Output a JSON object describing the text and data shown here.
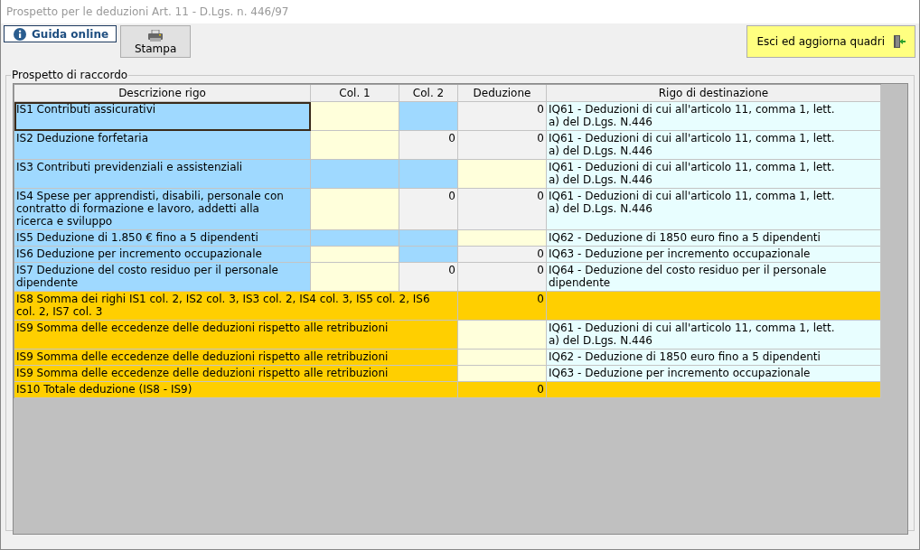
{
  "window": {
    "title": "Prospetto per le deduzioni Art. 11 - D.Lgs. n. 446/97"
  },
  "toolbar": {
    "help_button": "Guida online",
    "print_button": "Stampa",
    "exit_button": "Esci ed aggiorna quadri"
  },
  "group": {
    "title": "Prospetto di raccordo"
  },
  "table": {
    "columns": [
      "Descrizione rigo",
      "Col. 1",
      "Col. 2",
      "Deduzione",
      "Rigo di destinazione"
    ],
    "rows": [
      {
        "kind": "detail",
        "focused": true,
        "description": "IS1 Contributi assicurativi",
        "col1": {
          "kind": "input"
        },
        "col2": {
          "kind": "locked"
        },
        "deduzione": {
          "kind": "calc",
          "value": "0"
        },
        "destination": "IQ61 - Deduzioni di cui all'articolo 11, comma 1, lett. a) del D.Lgs. N.446"
      },
      {
        "kind": "detail",
        "focused": false,
        "description": "IS2 Deduzione forfetaria",
        "col1": {
          "kind": "input"
        },
        "col2": {
          "kind": "calc",
          "value": "0"
        },
        "deduzione": {
          "kind": "calc",
          "value": "0"
        },
        "destination": "IQ61 - Deduzioni di cui all'articolo 11, comma 1, lett. a) del D.Lgs. N.446"
      },
      {
        "kind": "detail",
        "focused": false,
        "description": "IS3 Contributi previdenziali e assistenziali",
        "col1": {
          "kind": "locked"
        },
        "col2": {
          "kind": "locked"
        },
        "deduzione": {
          "kind": "input"
        },
        "destination": "IQ61 - Deduzioni di cui all'articolo 11, comma 1, lett. a) del D.Lgs. N.446"
      },
      {
        "kind": "detail",
        "focused": false,
        "description": "IS4 Spese per apprendisti, disabili, personale con contratto di formazione e lavoro, addetti alla ricerca e sviluppo",
        "col1": {
          "kind": "input"
        },
        "col2": {
          "kind": "calc",
          "value": "0"
        },
        "deduzione": {
          "kind": "calc",
          "value": "0"
        },
        "destination": "IQ61 - Deduzioni di cui all'articolo 11, comma 1, lett. a) del D.Lgs. N.446"
      },
      {
        "kind": "detail",
        "focused": false,
        "description": "IS5 Deduzione di 1.850 € fino a 5 dipendenti",
        "col1": {
          "kind": "locked"
        },
        "col2": {
          "kind": "locked"
        },
        "deduzione": {
          "kind": "input"
        },
        "destination": "IQ62 - Deduzione di 1850 euro fino a 5 dipendenti"
      },
      {
        "kind": "detail",
        "focused": false,
        "description": "IS6 Deduzione per incremento occupazionale",
        "col1": {
          "kind": "input"
        },
        "col2": {
          "kind": "locked"
        },
        "deduzione": {
          "kind": "calc",
          "value": "0"
        },
        "destination": "IQ63 - Deduzione per incremento occupazionale"
      },
      {
        "kind": "detail",
        "focused": false,
        "description": "IS7 Deduzione del costo residuo per il personale dipendente",
        "col1": {
          "kind": "input"
        },
        "col2": {
          "kind": "calc",
          "value": "0"
        },
        "deduzione": {
          "kind": "calc",
          "value": "0"
        },
        "destination": "IQ64 - Deduzione del costo residuo per il personale dipendente"
      },
      {
        "kind": "total",
        "focused": false,
        "description": "IS8 Somma dei righi IS1 col. 2, IS2 col. 3, IS3 col. 2, IS4 col. 3, IS5 col. 2, IS6 col. 2, IS7 col. 3",
        "deduzione": {
          "kind": "total",
          "value": "0"
        }
      },
      {
        "kind": "total",
        "focused": false,
        "description": "IS9 Somma delle eccedenze delle deduzioni rispetto alle retribuzioni",
        "deduzione": {
          "kind": "input"
        },
        "destination": "IQ61 - Deduzioni di cui all'articolo 11, comma 1, lett. a) del D.Lgs. N.446"
      },
      {
        "kind": "total",
        "focused": false,
        "description": "IS9 Somma delle eccedenze delle deduzioni rispetto alle retribuzioni",
        "deduzione": {
          "kind": "input"
        },
        "destination": "IQ62 - Deduzione di 1850 euro fino a 5 dipendenti"
      },
      {
        "kind": "total",
        "focused": false,
        "description": "IS9 Somma delle eccedenze delle deduzioni rispetto alle retribuzioni",
        "deduzione": {
          "kind": "input"
        },
        "destination": "IQ63 - Deduzione per incremento occupazionale"
      },
      {
        "kind": "total",
        "focused": false,
        "description": "IS10 Totale deduzione (IS8 - IS9)",
        "deduzione": {
          "kind": "total",
          "value": "0"
        }
      }
    ]
  }
}
